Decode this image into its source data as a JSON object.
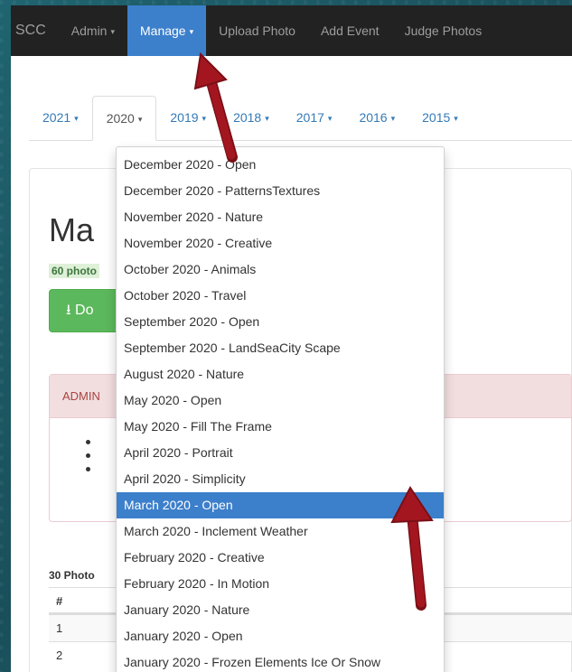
{
  "navbar": {
    "brand": "SCC",
    "items": [
      {
        "label": "Admin",
        "caret": "▾"
      },
      {
        "label": "Manage",
        "caret": "▾"
      },
      {
        "label": "Upload Photo"
      },
      {
        "label": "Add Event"
      },
      {
        "label": "Judge Photos"
      }
    ]
  },
  "tabs": [
    "2021",
    "2020",
    "2019",
    "2018",
    "2017",
    "2016",
    "2015"
  ],
  "tab_caret": "▾",
  "background": {
    "heading": "Ma",
    "count": "60 photo",
    "download_label": "⭳ Do",
    "alert_title": "ADMIN",
    "photos_label": "30 Photo",
    "table": {
      "header": "#",
      "rows": [
        "1",
        "2"
      ]
    }
  },
  "dropdown": {
    "items": [
      "December 2020 - Open",
      "December 2020 - PatternsTextures",
      "November 2020 - Nature",
      "November 2020 - Creative",
      "October 2020 - Animals",
      "October 2020 - Travel",
      "September 2020 - Open",
      "September 2020 - LandSeaCity Scape",
      "August 2020 - Nature",
      "May 2020 - Open",
      "May 2020 - Fill The Frame",
      "April 2020 - Portrait",
      "April 2020 - Simplicity",
      "March 2020 - Open",
      "March 2020 - Inclement Weather",
      "February 2020 - Creative",
      "February 2020 - In Motion",
      "January 2020 - Nature",
      "January 2020 - Open",
      "January 2020 - Frozen Elements Ice Or Snow"
    ],
    "selected": "March 2020 - Open"
  },
  "colors": {
    "navbar": "#222222",
    "accent": "#3c7fcb",
    "annotation_arrow": "#a4161f"
  },
  "icons": [
    "download-icon",
    "caret-down-icon",
    "annotation-arrow"
  ]
}
